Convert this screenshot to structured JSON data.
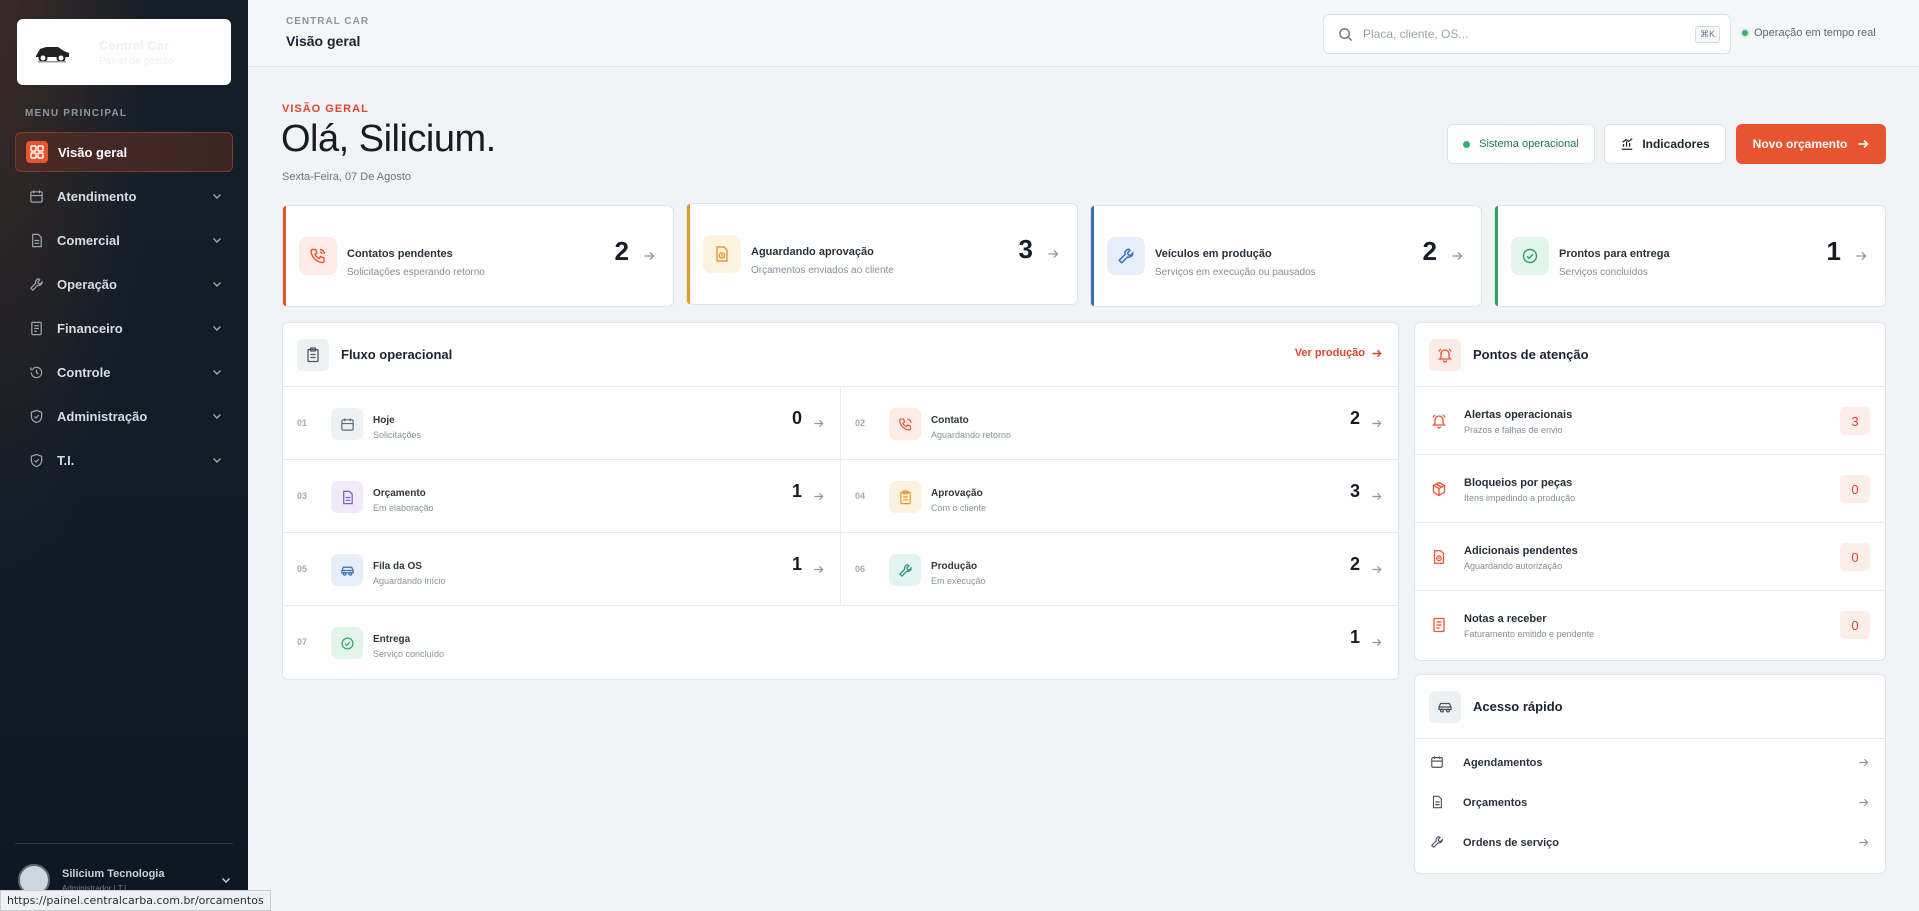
{
  "sidebar": {
    "brand_name": "Central Car",
    "brand_sub": "Painel de gestão",
    "menu_label": "MENU PRINCIPAL",
    "items": [
      {
        "label": "Visão geral",
        "icon": "dashboard-icon",
        "active": true
      },
      {
        "label": "Atendimento",
        "icon": "calendar-icon"
      },
      {
        "label": "Comercial",
        "icon": "document-icon"
      },
      {
        "label": "Operação",
        "icon": "wrench-icon"
      },
      {
        "label": "Financeiro",
        "icon": "receipt-icon"
      },
      {
        "label": "Controle",
        "icon": "history-icon"
      },
      {
        "label": "Administração",
        "icon": "shield-icon"
      },
      {
        "label": "T.I.",
        "icon": "shield-icon"
      }
    ],
    "user_name": "Silicium Tecnologia",
    "user_role": "Administrador | T.I."
  },
  "status_url": "https://painel.centralcarba.com.br/orcamentos",
  "topbar": {
    "eyebrow": "CENTRAL CAR",
    "title": "Visão geral",
    "search_placeholder": "Placa, cliente, OS...",
    "kbd": "⌘K",
    "live_label": "Operação em tempo real"
  },
  "header": {
    "eyebrow": "VISÃO GERAL",
    "greeting": "Olá, Silicium.",
    "date": "Sexta-Feira, 07 De Agosto",
    "status_btn": "Sistema operacional",
    "indicators_btn": "Indicadores",
    "new_btn": "Novo orçamento"
  },
  "stats": [
    {
      "title": "Contatos pendentes",
      "sub": "Solicitações esperando retorno",
      "value": "2",
      "color": "#e8542f",
      "bg": "#fdece6",
      "icon": "phone-icon"
    },
    {
      "title": "Aguardando aprovação",
      "sub": "Orçamentos enviados ao cliente",
      "value": "3",
      "color": "#e39a2b",
      "bg": "#fdf1e0",
      "icon": "money-doc-icon"
    },
    {
      "title": "Veículos em produção",
      "sub": "Serviços em execução ou pausados",
      "value": "2",
      "color": "#3a6fb5",
      "bg": "#e6eef9",
      "icon": "wrench-icon"
    },
    {
      "title": "Prontos para entrega",
      "sub": "Serviços concluídos",
      "value": "1",
      "color": "#2fa366",
      "bg": "#e3f4ea",
      "icon": "check-circle-icon"
    }
  ],
  "flux": {
    "title": "Fluxo operacional",
    "link": "Ver produção",
    "items": [
      {
        "num": "01",
        "title": "Hoje",
        "sub": "Solicitações",
        "value": "0",
        "icon": "calendar-icon",
        "color": "#5f6b77",
        "bg": "#eef1f4"
      },
      {
        "num": "02",
        "title": "Contato",
        "sub": "Aguardando retorno",
        "value": "2",
        "icon": "phone-icon",
        "color": "#e8542f",
        "bg": "#fdece6"
      },
      {
        "num": "03",
        "title": "Orçamento",
        "sub": "Em elaboração",
        "value": "1",
        "icon": "document-icon",
        "color": "#7b5bc4",
        "bg": "#f0ebfa"
      },
      {
        "num": "04",
        "title": "Aprovação",
        "sub": "Com o cliente",
        "value": "3",
        "icon": "clipboard-icon",
        "color": "#e39a2b",
        "bg": "#fdf1e0"
      },
      {
        "num": "05",
        "title": "Fila da OS",
        "sub": "Aguardando início",
        "value": "1",
        "icon": "car-icon",
        "color": "#3a6fb5",
        "bg": "#e6eef9"
      },
      {
        "num": "06",
        "title": "Produção",
        "sub": "Em execução",
        "value": "2",
        "icon": "wrench-icon",
        "color": "#2a8f8a",
        "bg": "#e3f3f2"
      },
      {
        "num": "07",
        "title": "Entrega",
        "sub": "Serviço concluído",
        "value": "1",
        "icon": "check-circle-icon",
        "color": "#2fa366",
        "bg": "#e3f4ea"
      }
    ]
  },
  "attention": {
    "title": "Pontos de atenção",
    "items": [
      {
        "title": "Alertas operacionais",
        "sub": "Prazos e falhas de envio",
        "value": "3",
        "icon": "bell-icon"
      },
      {
        "title": "Bloqueios por peças",
        "sub": "Itens impedindo a produção",
        "value": "0",
        "icon": "package-icon"
      },
      {
        "title": "Adicionais pendentes",
        "sub": "Aguardando autorização",
        "value": "0",
        "icon": "money-doc-icon"
      },
      {
        "title": "Notas a receber",
        "sub": "Faturamento emitido e pendente",
        "value": "0",
        "icon": "receipt-icon"
      }
    ]
  },
  "quick": {
    "title": "Acesso rápido",
    "items": [
      {
        "title": "Agendamentos",
        "icon": "calendar-icon"
      },
      {
        "title": "Orçamentos",
        "icon": "document-icon"
      },
      {
        "title": "Ordens de serviço",
        "icon": "wrench-icon"
      }
    ]
  },
  "colors": {
    "accent": "#e8542f",
    "sidebar_bg": "#0f1b26",
    "success": "#2fb36c"
  }
}
